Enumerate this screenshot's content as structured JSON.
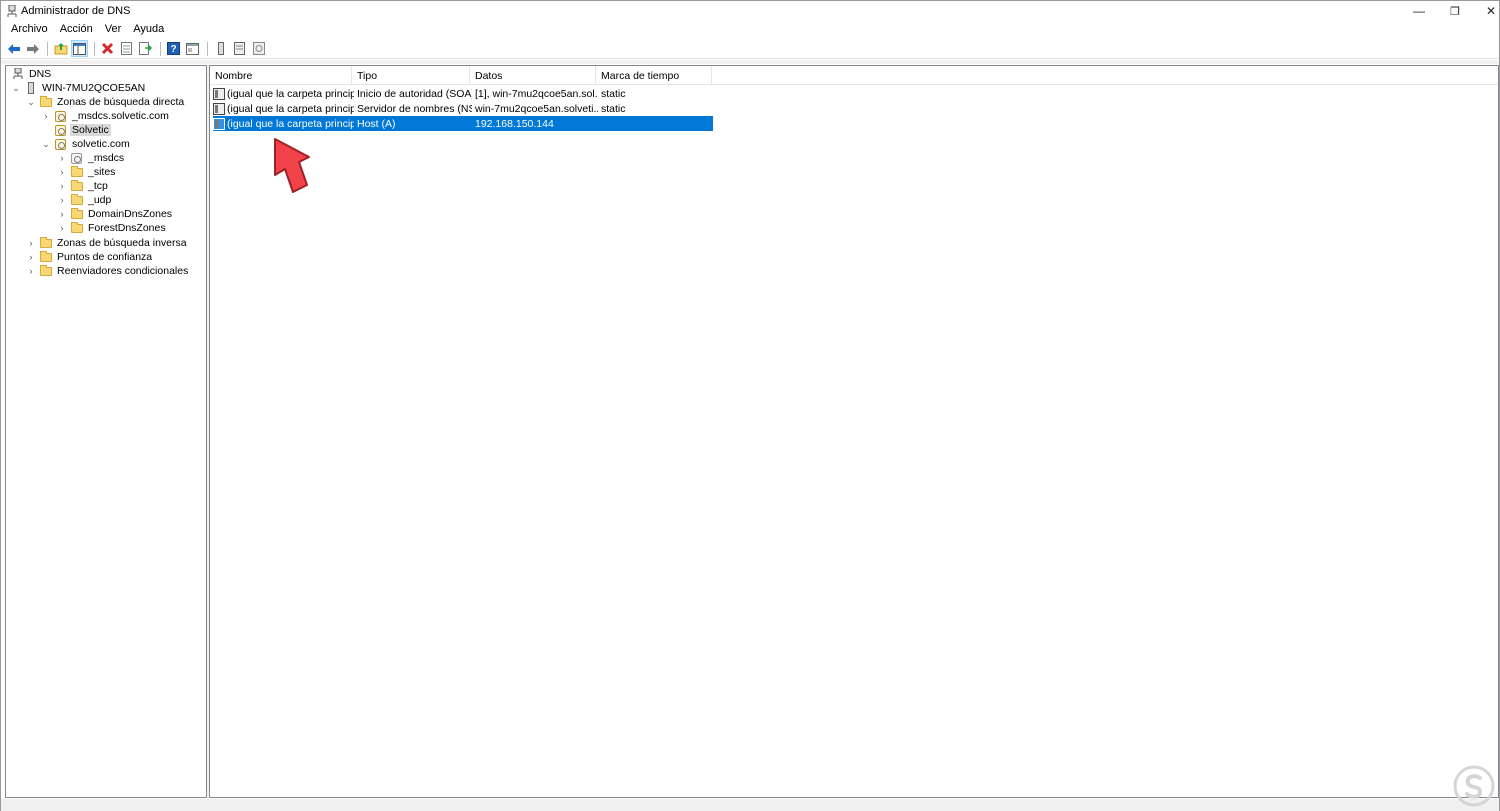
{
  "window": {
    "title": "Administrador de DNS"
  },
  "titlebar": {
    "minimize": "—",
    "restore": "❐",
    "close": "✕"
  },
  "menu": {
    "file": "Archivo",
    "action": "Acción",
    "view": "Ver",
    "help": "Ayuda"
  },
  "toolbar": {
    "buttons": [
      "back-icon",
      "forward-icon",
      "up-folder-icon",
      "show-tree-icon",
      "delete-icon",
      "properties-icon",
      "export-icon",
      "help-icon",
      "console-icon",
      "server-icon",
      "list-icon",
      "refresh-icon"
    ]
  },
  "tree": {
    "root": "DNS",
    "server": "WIN-7MU2QCOE5AN",
    "forward": "Zonas de búsqueda directa",
    "msdcs_zone": "_msdcs.solvetic.com",
    "solvetic_upper": "Solvetic",
    "solvetic_com": "solvetic.com",
    "msdcs": "_msdcs",
    "sites": "_sites",
    "tcp": "_tcp",
    "udp": "_udp",
    "domaindns": "DomainDnsZones",
    "forestdns": "ForestDnsZones",
    "reverse": "Zonas de búsqueda inversa",
    "trust": "Puntos de confianza",
    "forwarders": "Reenviadores condicionales"
  },
  "list": {
    "columns": [
      "Nombre",
      "Tipo",
      "Datos",
      "Marca de tiempo"
    ],
    "rows": [
      {
        "name": "(igual que la carpeta princip...",
        "type": "Inicio de autoridad (SOA)",
        "data": "[1], win-7mu2qcoe5an.sol...",
        "timestamp": "static"
      },
      {
        "name": "(igual que la carpeta princip...",
        "type": "Servidor de nombres (NS)",
        "data": "win-7mu2qcoe5an.solveti...",
        "timestamp": "static"
      },
      {
        "name": "(igual que la carpeta princip...",
        "type": "Host (A)",
        "data": "192.168.150.144",
        "timestamp": ""
      }
    ]
  },
  "colors": {
    "selection": "#0078d7",
    "arrow": "#f2434a",
    "folder": "#f8d775"
  }
}
